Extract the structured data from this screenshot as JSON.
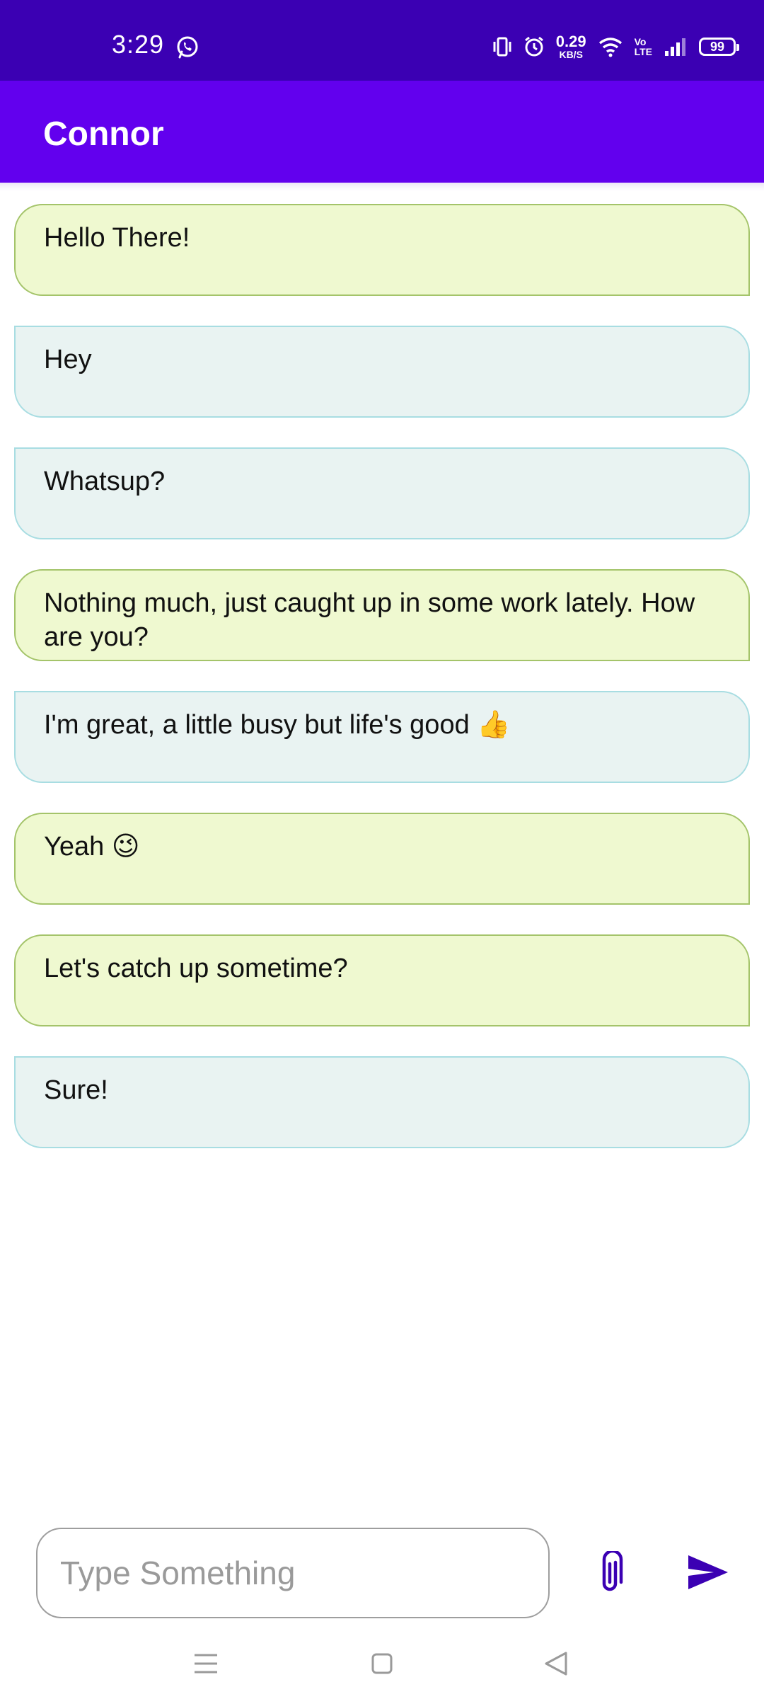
{
  "status_bar": {
    "time": "3:29",
    "net_speed_value": "0.29",
    "net_speed_unit": "KB/S",
    "volte_top": "Vo",
    "volte_bottom": "LTE",
    "battery": "99",
    "icons": [
      "whatsapp-icon",
      "vibrate-icon",
      "alarm-icon",
      "wifi-icon",
      "signal-icon",
      "battery-icon"
    ]
  },
  "app_bar": {
    "title": "Connor"
  },
  "messages": [
    {
      "type": "sent",
      "text": "Hello There!"
    },
    {
      "type": "received",
      "text": "Hey"
    },
    {
      "type": "received",
      "text": "Whatsup?"
    },
    {
      "type": "sent",
      "text": "Nothing much, just caught up in some work lately. How are you?"
    },
    {
      "type": "received",
      "text": "I'm great, a little busy but life's good 👍"
    },
    {
      "type": "sent",
      "text": "Yeah 😉"
    },
    {
      "type": "sent",
      "text": "Let's catch up sometime?"
    },
    {
      "type": "received",
      "text": "Sure!"
    }
  ],
  "composer": {
    "placeholder": "Type Something",
    "value": "",
    "attach_icon": "paperclip-icon",
    "send_icon": "send-icon"
  },
  "nav_bar": {
    "icons": [
      "menu-icon",
      "home-icon",
      "back-icon"
    ]
  },
  "colors": {
    "status_bar": "#3b00b3",
    "app_bar": "#6200ee",
    "sent_bubble": "#eff9d0",
    "sent_border": "#a4c46a",
    "received_bubble": "#e9f3f2",
    "received_border": "#a8dde2",
    "accent_icon": "#3b00b3"
  }
}
